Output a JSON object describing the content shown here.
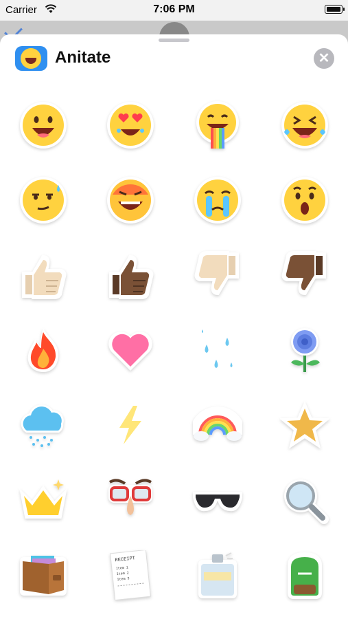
{
  "status_bar": {
    "carrier": "Carrier",
    "time": "7:06 PM"
  },
  "header": {
    "title": "Anitate",
    "close_glyph": "✕"
  },
  "stickers": [
    [
      "grinning-face-sticker",
      "heart-eyes-face-sticker",
      "rainbow-tongue-face-sticker",
      "laughing-tears-face-sticker"
    ],
    [
      "sweat-smirk-face-sticker",
      "angry-laughing-face-sticker",
      "crying-face-sticker",
      "surprised-face-sticker"
    ],
    [
      "thumbs-up-light-sticker",
      "thumbs-up-dark-sticker",
      "thumbs-down-light-sticker",
      "thumbs-down-dark-sticker"
    ],
    [
      "fire-sticker",
      "heart-sticker",
      "water-drops-sticker",
      "blue-flower-sticker"
    ],
    [
      "rain-cloud-sticker",
      "lightning-bolt-sticker",
      "rainbow-sticker",
      "star-sticker"
    ],
    [
      "crown-sticker",
      "nose-glasses-sticker",
      "sunglasses-sticker",
      "magnifying-glass-sticker"
    ],
    [
      "wallet-sticker",
      "receipt-sticker",
      "perfume-bottle-sticker",
      "backpack-sticker"
    ]
  ],
  "receipt": {
    "header": "RECEIPT",
    "lines": [
      "Item 1",
      "Item 2",
      "Item 3"
    ]
  },
  "colors": {
    "sheet": "#ffffff",
    "accent": "#2f8ff0",
    "emoji_yellow": "#ffd23f"
  }
}
